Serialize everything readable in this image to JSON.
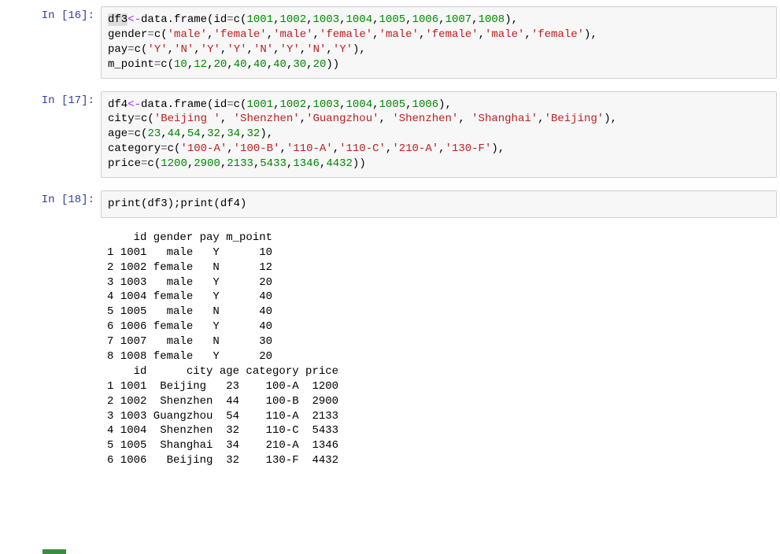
{
  "cells": {
    "cell16": {
      "prompt": "In  [16]:",
      "tokens": [
        {
          "t": "df3",
          "c": "id hl"
        },
        {
          "t": "<-",
          "c": "op"
        },
        {
          "t": "data.frame(id",
          "c": "k"
        },
        {
          "t": "=",
          "c": "eq"
        },
        {
          "t": "c(",
          "c": "k"
        },
        {
          "t": "1001",
          "c": "num"
        },
        {
          "t": ",",
          "c": "k"
        },
        {
          "t": "1002",
          "c": "num"
        },
        {
          "t": ",",
          "c": "k"
        },
        {
          "t": "1003",
          "c": "num"
        },
        {
          "t": ",",
          "c": "k"
        },
        {
          "t": "1004",
          "c": "num"
        },
        {
          "t": ",",
          "c": "k"
        },
        {
          "t": "1005",
          "c": "num"
        },
        {
          "t": ",",
          "c": "k"
        },
        {
          "t": "1006",
          "c": "num"
        },
        {
          "t": ",",
          "c": "k"
        },
        {
          "t": "1007",
          "c": "num"
        },
        {
          "t": ",",
          "c": "k"
        },
        {
          "t": "1008",
          "c": "num"
        },
        {
          "t": "),",
          "c": "k"
        },
        {
          "t": "\n",
          "c": "k"
        },
        {
          "t": "gender",
          "c": "k"
        },
        {
          "t": "=",
          "c": "eq"
        },
        {
          "t": "c(",
          "c": "k"
        },
        {
          "t": "'male'",
          "c": "str"
        },
        {
          "t": ",",
          "c": "k"
        },
        {
          "t": "'female'",
          "c": "str"
        },
        {
          "t": ",",
          "c": "k"
        },
        {
          "t": "'male'",
          "c": "str"
        },
        {
          "t": ",",
          "c": "k"
        },
        {
          "t": "'female'",
          "c": "str"
        },
        {
          "t": ",",
          "c": "k"
        },
        {
          "t": "'male'",
          "c": "str"
        },
        {
          "t": ",",
          "c": "k"
        },
        {
          "t": "'female'",
          "c": "str"
        },
        {
          "t": ",",
          "c": "k"
        },
        {
          "t": "'male'",
          "c": "str"
        },
        {
          "t": ",",
          "c": "k"
        },
        {
          "t": "'female'",
          "c": "str"
        },
        {
          "t": "),",
          "c": "k"
        },
        {
          "t": "\n",
          "c": "k"
        },
        {
          "t": "pay",
          "c": "k"
        },
        {
          "t": "=",
          "c": "eq"
        },
        {
          "t": "c(",
          "c": "k"
        },
        {
          "t": "'Y'",
          "c": "str"
        },
        {
          "t": ",",
          "c": "k"
        },
        {
          "t": "'N'",
          "c": "str"
        },
        {
          "t": ",",
          "c": "k"
        },
        {
          "t": "'Y'",
          "c": "str"
        },
        {
          "t": ",",
          "c": "k"
        },
        {
          "t": "'Y'",
          "c": "str"
        },
        {
          "t": ",",
          "c": "k"
        },
        {
          "t": "'N'",
          "c": "str"
        },
        {
          "t": ",",
          "c": "k"
        },
        {
          "t": "'Y'",
          "c": "str"
        },
        {
          "t": ",",
          "c": "k"
        },
        {
          "t": "'N'",
          "c": "str"
        },
        {
          "t": ",",
          "c": "k"
        },
        {
          "t": "'Y'",
          "c": "str"
        },
        {
          "t": "),",
          "c": "k"
        },
        {
          "t": "\n",
          "c": "k"
        },
        {
          "t": "m_point",
          "c": "k"
        },
        {
          "t": "=",
          "c": "eq"
        },
        {
          "t": "c(",
          "c": "k"
        },
        {
          "t": "10",
          "c": "num"
        },
        {
          "t": ",",
          "c": "k"
        },
        {
          "t": "12",
          "c": "num"
        },
        {
          "t": ",",
          "c": "k"
        },
        {
          "t": "20",
          "c": "num"
        },
        {
          "t": ",",
          "c": "k"
        },
        {
          "t": "40",
          "c": "num"
        },
        {
          "t": ",",
          "c": "k"
        },
        {
          "t": "40",
          "c": "num"
        },
        {
          "t": ",",
          "c": "k"
        },
        {
          "t": "40",
          "c": "num"
        },
        {
          "t": ",",
          "c": "k"
        },
        {
          "t": "30",
          "c": "num"
        },
        {
          "t": ",",
          "c": "k"
        },
        {
          "t": "20",
          "c": "num"
        },
        {
          "t": "))",
          "c": "k"
        }
      ]
    },
    "cell17": {
      "prompt": "In  [17]:",
      "tokens": [
        {
          "t": "df4",
          "c": "id"
        },
        {
          "t": "<-",
          "c": "op"
        },
        {
          "t": "data.frame(id",
          "c": "k"
        },
        {
          "t": "=",
          "c": "eq"
        },
        {
          "t": "c(",
          "c": "k"
        },
        {
          "t": "1001",
          "c": "num"
        },
        {
          "t": ",",
          "c": "k"
        },
        {
          "t": "1002",
          "c": "num"
        },
        {
          "t": ",",
          "c": "k"
        },
        {
          "t": "1003",
          "c": "num"
        },
        {
          "t": ",",
          "c": "k"
        },
        {
          "t": "1004",
          "c": "num"
        },
        {
          "t": ",",
          "c": "k"
        },
        {
          "t": "1005",
          "c": "num"
        },
        {
          "t": ",",
          "c": "k"
        },
        {
          "t": "1006",
          "c": "num"
        },
        {
          "t": "),",
          "c": "k"
        },
        {
          "t": "\n",
          "c": "k"
        },
        {
          "t": "city",
          "c": "k"
        },
        {
          "t": "=",
          "c": "eq"
        },
        {
          "t": "c(",
          "c": "k"
        },
        {
          "t": "'Beijing '",
          "c": "str"
        },
        {
          "t": ", ",
          "c": "k"
        },
        {
          "t": "'Shenzhen'",
          "c": "str"
        },
        {
          "t": ",",
          "c": "k"
        },
        {
          "t": "'Guangzhou'",
          "c": "str"
        },
        {
          "t": ", ",
          "c": "k"
        },
        {
          "t": "'Shenzhen'",
          "c": "str"
        },
        {
          "t": ", ",
          "c": "k"
        },
        {
          "t": "'Shanghai'",
          "c": "str"
        },
        {
          "t": ",",
          "c": "k"
        },
        {
          "t": "'Beijing'",
          "c": "str"
        },
        {
          "t": "),",
          "c": "k"
        },
        {
          "t": "\n",
          "c": "k"
        },
        {
          "t": "age",
          "c": "k"
        },
        {
          "t": "=",
          "c": "eq"
        },
        {
          "t": "c(",
          "c": "k"
        },
        {
          "t": "23",
          "c": "num"
        },
        {
          "t": ",",
          "c": "k"
        },
        {
          "t": "44",
          "c": "num"
        },
        {
          "t": ",",
          "c": "k"
        },
        {
          "t": "54",
          "c": "num"
        },
        {
          "t": ",",
          "c": "k"
        },
        {
          "t": "32",
          "c": "num"
        },
        {
          "t": ",",
          "c": "k"
        },
        {
          "t": "34",
          "c": "num"
        },
        {
          "t": ",",
          "c": "k"
        },
        {
          "t": "32",
          "c": "num"
        },
        {
          "t": "),",
          "c": "k"
        },
        {
          "t": "\n",
          "c": "k"
        },
        {
          "t": "category",
          "c": "k"
        },
        {
          "t": "=",
          "c": "eq"
        },
        {
          "t": "c(",
          "c": "k"
        },
        {
          "t": "'100-A'",
          "c": "str"
        },
        {
          "t": ",",
          "c": "k"
        },
        {
          "t": "'100-B'",
          "c": "str"
        },
        {
          "t": ",",
          "c": "k"
        },
        {
          "t": "'110-A'",
          "c": "str"
        },
        {
          "t": ",",
          "c": "k"
        },
        {
          "t": "'110-C'",
          "c": "str"
        },
        {
          "t": ",",
          "c": "k"
        },
        {
          "t": "'210-A'",
          "c": "str"
        },
        {
          "t": ",",
          "c": "k"
        },
        {
          "t": "'130-F'",
          "c": "str"
        },
        {
          "t": "),",
          "c": "k"
        },
        {
          "t": "\n",
          "c": "k"
        },
        {
          "t": "price",
          "c": "k"
        },
        {
          "t": "=",
          "c": "eq"
        },
        {
          "t": "c(",
          "c": "k"
        },
        {
          "t": "1200",
          "c": "num"
        },
        {
          "t": ",",
          "c": "k"
        },
        {
          "t": "2900",
          "c": "num"
        },
        {
          "t": ",",
          "c": "k"
        },
        {
          "t": "2133",
          "c": "num"
        },
        {
          "t": ",",
          "c": "k"
        },
        {
          "t": "5433",
          "c": "num"
        },
        {
          "t": ",",
          "c": "k"
        },
        {
          "t": "1346",
          "c": "num"
        },
        {
          "t": ",",
          "c": "k"
        },
        {
          "t": "4432",
          "c": "num"
        },
        {
          "t": "))",
          "c": "k"
        }
      ]
    },
    "cell18": {
      "prompt": "In  [18]:",
      "tokens": [
        {
          "t": "print(df3);print(df4)",
          "c": "k"
        }
      ],
      "output": "    id gender pay m_point\n1 1001   male   Y      10\n2 1002 female   N      12\n3 1003   male   Y      20\n4 1004 female   Y      40\n5 1005   male   N      40\n6 1006 female   Y      40\n7 1007   male   N      30\n8 1008 female   Y      20\n    id      city age category price\n1 1001  Beijing   23    100-A  1200\n2 1002  Shenzhen  44    100-B  2900\n3 1003 Guangzhou  54    110-A  2133\n4 1004  Shenzhen  32    110-C  5433\n5 1005  Shanghai  34    210-A  1346\n6 1006   Beijing  32    130-F  4432"
    }
  }
}
